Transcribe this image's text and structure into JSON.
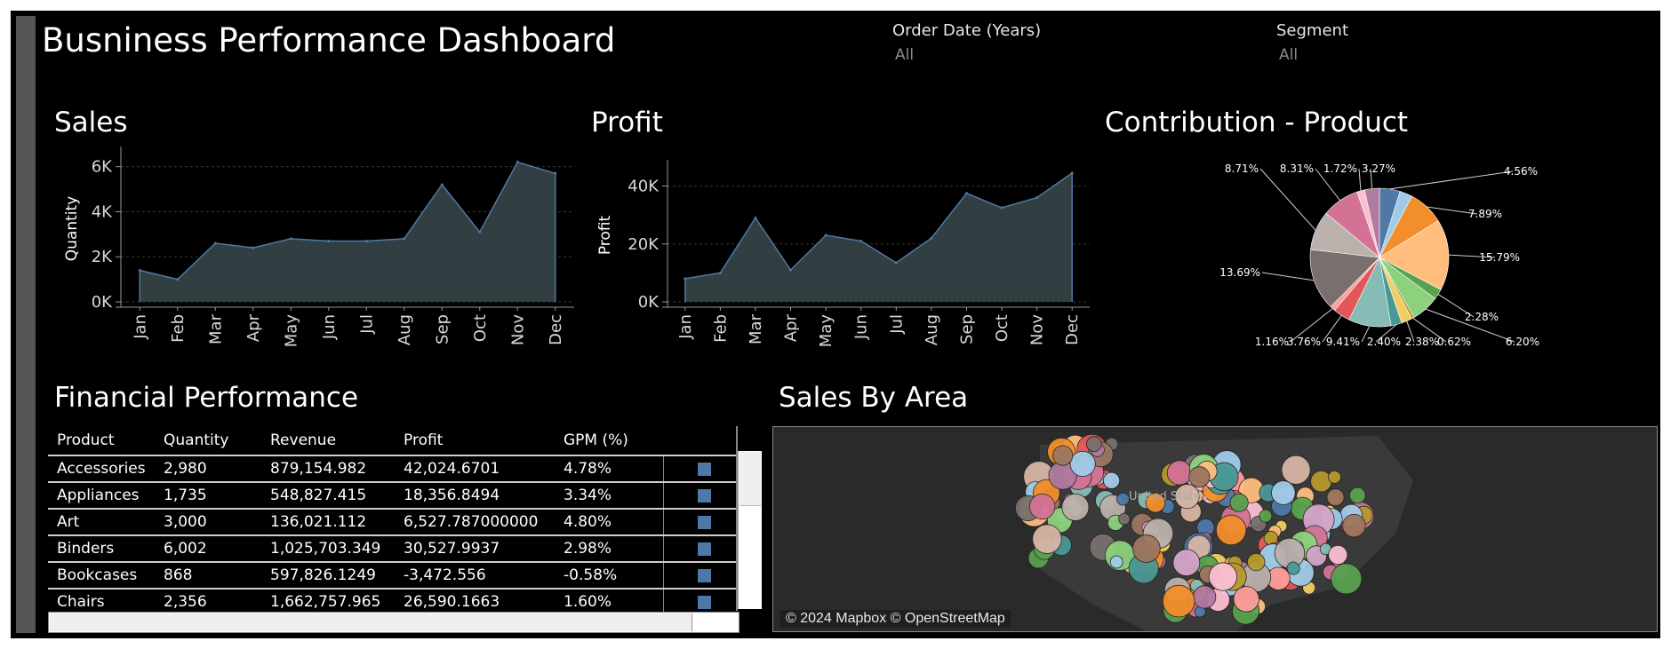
{
  "dashboard": {
    "title": "Busniness Performance Dashboard"
  },
  "filters": [
    {
      "label": "Order Date (Years)",
      "value": "All"
    },
    {
      "label": "Segment",
      "value": "All"
    }
  ],
  "sections": {
    "sales": "Sales",
    "profit": "Profit",
    "contribution": "Contribution - Product",
    "financial": "Financial Performance",
    "map": "Sales By Area"
  },
  "chart_data": [
    {
      "type": "area",
      "title": "Sales",
      "ylabel": "Quantity",
      "categories": [
        "Jan",
        "Feb",
        "Mar",
        "Apr",
        "May",
        "Jun",
        "Jul",
        "Aug",
        "Sep",
        "Oct",
        "Nov",
        "Dec"
      ],
      "values": [
        1400,
        1000,
        2600,
        2400,
        2800,
        2700,
        2700,
        2800,
        5200,
        3100,
        6200,
        5700
      ],
      "yticks": [
        0,
        2000,
        4000,
        6000
      ],
      "ytick_labels": [
        "0K",
        "2K",
        "4K",
        "6K"
      ],
      "ylim": [
        0,
        6500
      ],
      "color": "#4e79a7",
      "fill": "#323f42"
    },
    {
      "type": "area",
      "title": "Profit",
      "ylabel": "Profit",
      "categories": [
        "Jan",
        "Feb",
        "Mar",
        "Apr",
        "May",
        "Jun",
        "Jul",
        "Aug",
        "Sep",
        "Oct",
        "Nov",
        "Dec"
      ],
      "values": [
        8000,
        10000,
        29000,
        11000,
        23000,
        21000,
        13500,
        22000,
        37500,
        32500,
        36000,
        44500
      ],
      "yticks": [
        0,
        20000,
        40000
      ],
      "ytick_labels": [
        "0K",
        "20K",
        "40K"
      ],
      "ylim": [
        0,
        46000
      ],
      "color": "#4e79a7",
      "fill": "#323f42"
    },
    {
      "type": "pie",
      "title": "Contribution - Product",
      "slices": [
        {
          "value": 4.56,
          "label": "4.56%",
          "color": "#4e79a7"
        },
        {
          "value": 2.84,
          "label": "",
          "color": "#a0cbe8"
        },
        {
          "value": 7.89,
          "label": "7.89%",
          "color": "#f28e2b"
        },
        {
          "value": 15.79,
          "label": "15.79%",
          "color": "#ffbe7d"
        },
        {
          "value": 2.28,
          "label": "2.28%",
          "color": "#59a14f"
        },
        {
          "value": 6.2,
          "label": "6.20%",
          "color": "#8cd17d"
        },
        {
          "value": 0.62,
          "label": "0.62%",
          "color": "#b6992d"
        },
        {
          "value": 2.38,
          "label": "2.38%",
          "color": "#f1ce63"
        },
        {
          "value": 2.4,
          "label": "2.40%",
          "color": "#499894"
        },
        {
          "value": 9.41,
          "label": "9.41%",
          "color": "#86bcb6"
        },
        {
          "value": 3.76,
          "label": "3.76%",
          "color": "#e15759"
        },
        {
          "value": 1.16,
          "label": "1.16%",
          "color": "#ff9d9a"
        },
        {
          "value": 13.69,
          "label": "13.69%",
          "color": "#79706e"
        },
        {
          "value": 8.71,
          "label": "8.71%",
          "color": "#bab0ac"
        },
        {
          "value": 8.31,
          "label": "8.31%",
          "color": "#d37295"
        },
        {
          "value": 1.72,
          "label": "1.72%",
          "color": "#fabfd2"
        },
        {
          "value": 3.27,
          "label": "3.27%",
          "color": "#b07aa1"
        }
      ]
    }
  ],
  "financial_table": {
    "columns": [
      "Product",
      "Quantity",
      "Revenue",
      "Profit",
      "GPM (%)"
    ],
    "rows": [
      [
        "Accessories",
        "2,980",
        "879,154.982",
        "42,024.6701",
        "4.78%"
      ],
      [
        "Appliances",
        "1,735",
        "548,827.415",
        "18,356.8494",
        "3.34%"
      ],
      [
        "Art",
        "3,000",
        "136,021.112",
        "6,527.787000000",
        "4.80%"
      ],
      [
        "Binders",
        "6,002",
        "1,025,703.349",
        "30,527.9937",
        "2.98%"
      ],
      [
        "Bookcases",
        "868",
        "597,826.1249",
        "-3,472.556",
        "-0.58%"
      ],
      [
        "Chairs",
        "2,356",
        "1,662,757.965",
        "26,590.1663",
        "1.60%"
      ]
    ],
    "marker_color": "#4e79a7"
  },
  "map": {
    "attribution": "© 2024 Mapbox © OpenStreetMap",
    "label": "United States",
    "palette": [
      "#4e79a7",
      "#a0cbe8",
      "#f28e2b",
      "#ffbe7d",
      "#59a14f",
      "#8cd17d",
      "#b6992d",
      "#f1ce63",
      "#499894",
      "#86bcb6",
      "#e15759",
      "#ff9d9a",
      "#79706e",
      "#bab0ac",
      "#d37295",
      "#fabfd2",
      "#b07aa1",
      "#d4a6c8",
      "#9d7660",
      "#d7b5a6"
    ]
  }
}
